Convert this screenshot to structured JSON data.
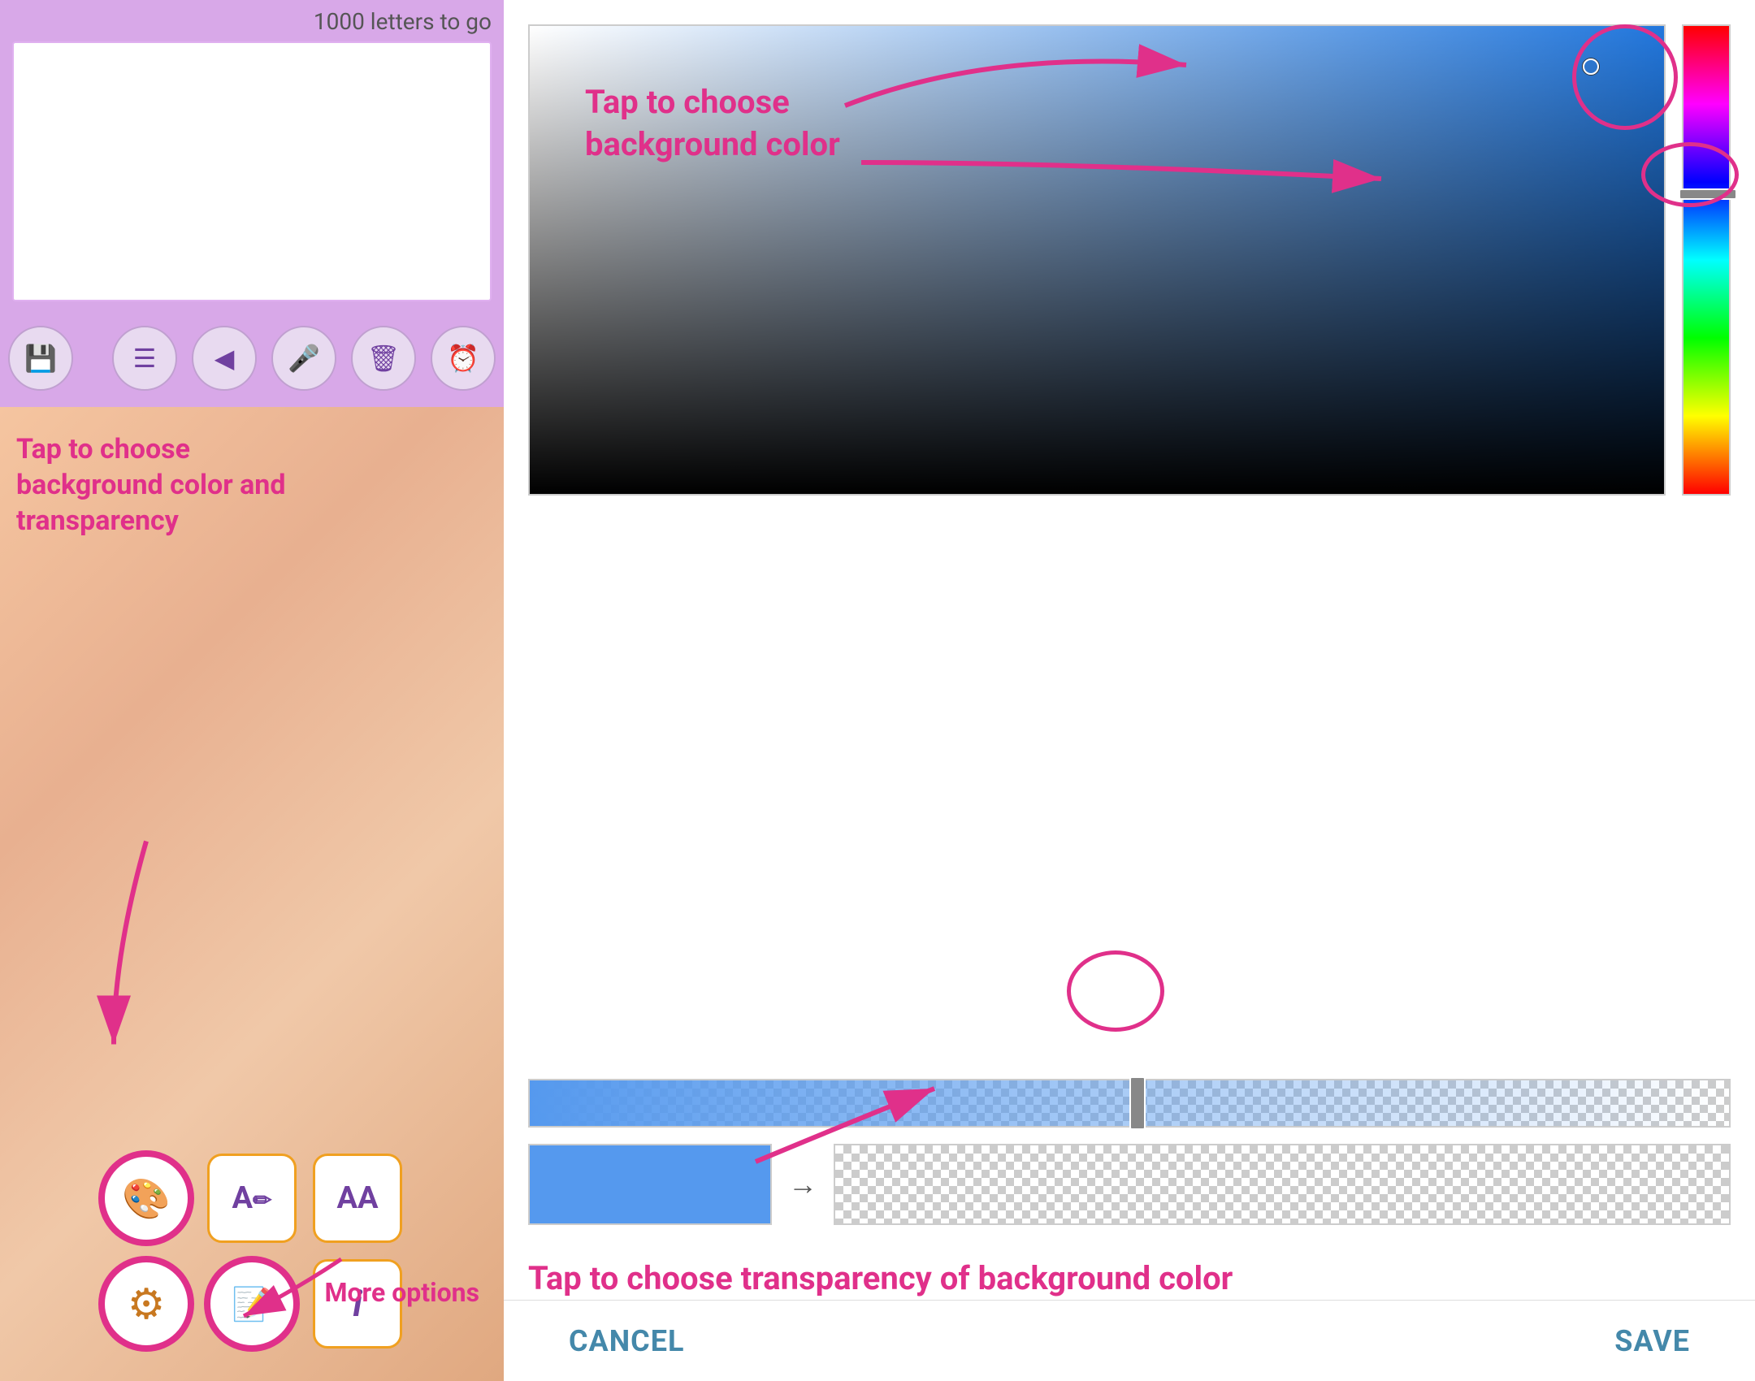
{
  "left": {
    "letterCount": "1000 letters to go",
    "annotationBg": "Tap to choose background color and transparency",
    "annotationMore": "More options",
    "toolbar": {
      "save": "💾",
      "align": "≡",
      "share": "◁",
      "mic": "🎤",
      "delete": "🗑",
      "alarm": "⏰"
    },
    "icons": {
      "palette": "🎨",
      "textStyle": "A✏",
      "fontSize": "AA",
      "gear": "⚙",
      "memo": "📝",
      "info": "i"
    }
  },
  "right": {
    "annotationBgColor": "Tap to choose background color",
    "annotationTransparency": "Tap to choose transparency of background color",
    "cancelLabel": "CANCEL",
    "saveLabel": "SAVE"
  }
}
